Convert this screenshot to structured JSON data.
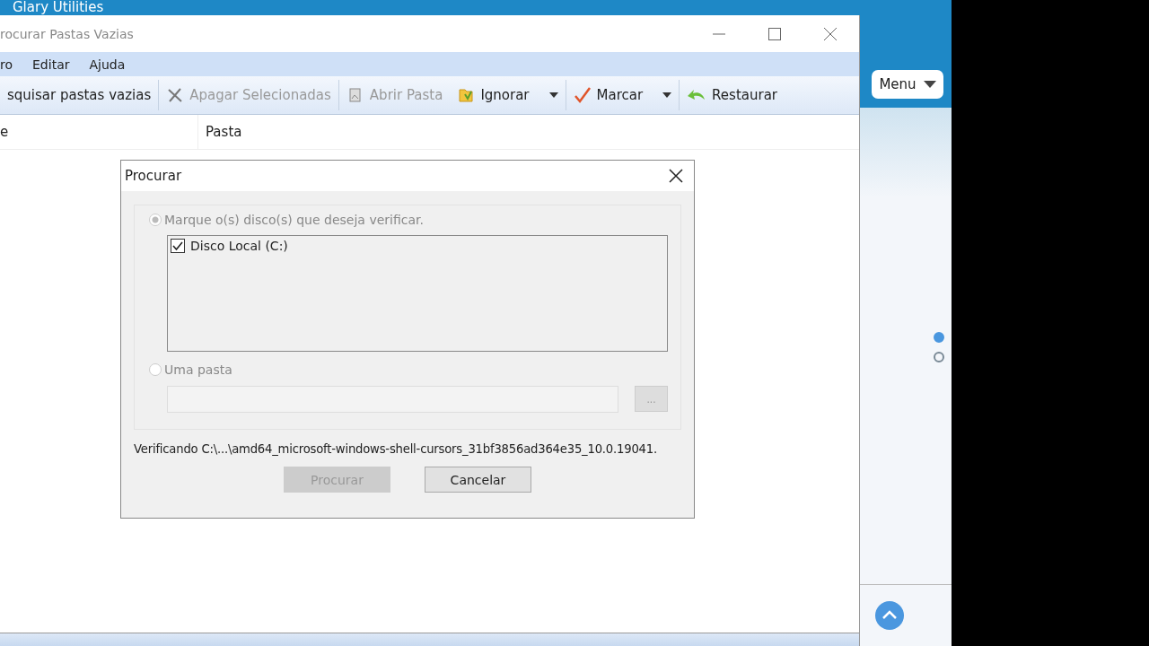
{
  "app_title": "Glary Utilities",
  "window": {
    "title": "rocurar Pastas Vazias"
  },
  "menu": [
    "ro",
    "Editar",
    "Ajuda"
  ],
  "toolbar": [
    {
      "label": "squisar pastas vazias",
      "kind": "plain",
      "disabled": false,
      "dropdown": false
    },
    {
      "label": "Apagar Selecionadas",
      "kind": "cross",
      "disabled": true,
      "dropdown": false
    },
    {
      "label": "Abrir Pasta",
      "kind": "folder",
      "disabled": true,
      "dropdown": false
    },
    {
      "label": "Ignorar",
      "kind": "ignore",
      "disabled": false,
      "dropdown": true
    },
    {
      "label": "Marcar",
      "kind": "check",
      "disabled": false,
      "dropdown": true
    },
    {
      "label": "Restaurar",
      "kind": "restore",
      "disabled": false,
      "dropdown": false
    }
  ],
  "table": {
    "columns": [
      "e",
      "Pasta"
    ]
  },
  "dialog": {
    "title": "Procurar",
    "options": [
      {
        "label": "Marque o(s) disco(s) que deseja verificar.",
        "selected": true
      },
      {
        "label": "Uma pasta",
        "selected": false
      }
    ],
    "drives": [
      {
        "label": "Disco Local (C:)",
        "checked": true
      }
    ],
    "browse_button": "...",
    "status": "Verificando C:\\...\\amd64_microsoft-windows-shell-cursors_31bf3856ad364e35_10.0.19041.",
    "buttons": [
      {
        "label": "Procurar",
        "disabled": true
      },
      {
        "label": "Cancelar",
        "disabled": false
      }
    ]
  },
  "side": {
    "menu_button": "Menu",
    "pages": [
      {
        "selected": true
      },
      {
        "selected": false
      }
    ]
  }
}
